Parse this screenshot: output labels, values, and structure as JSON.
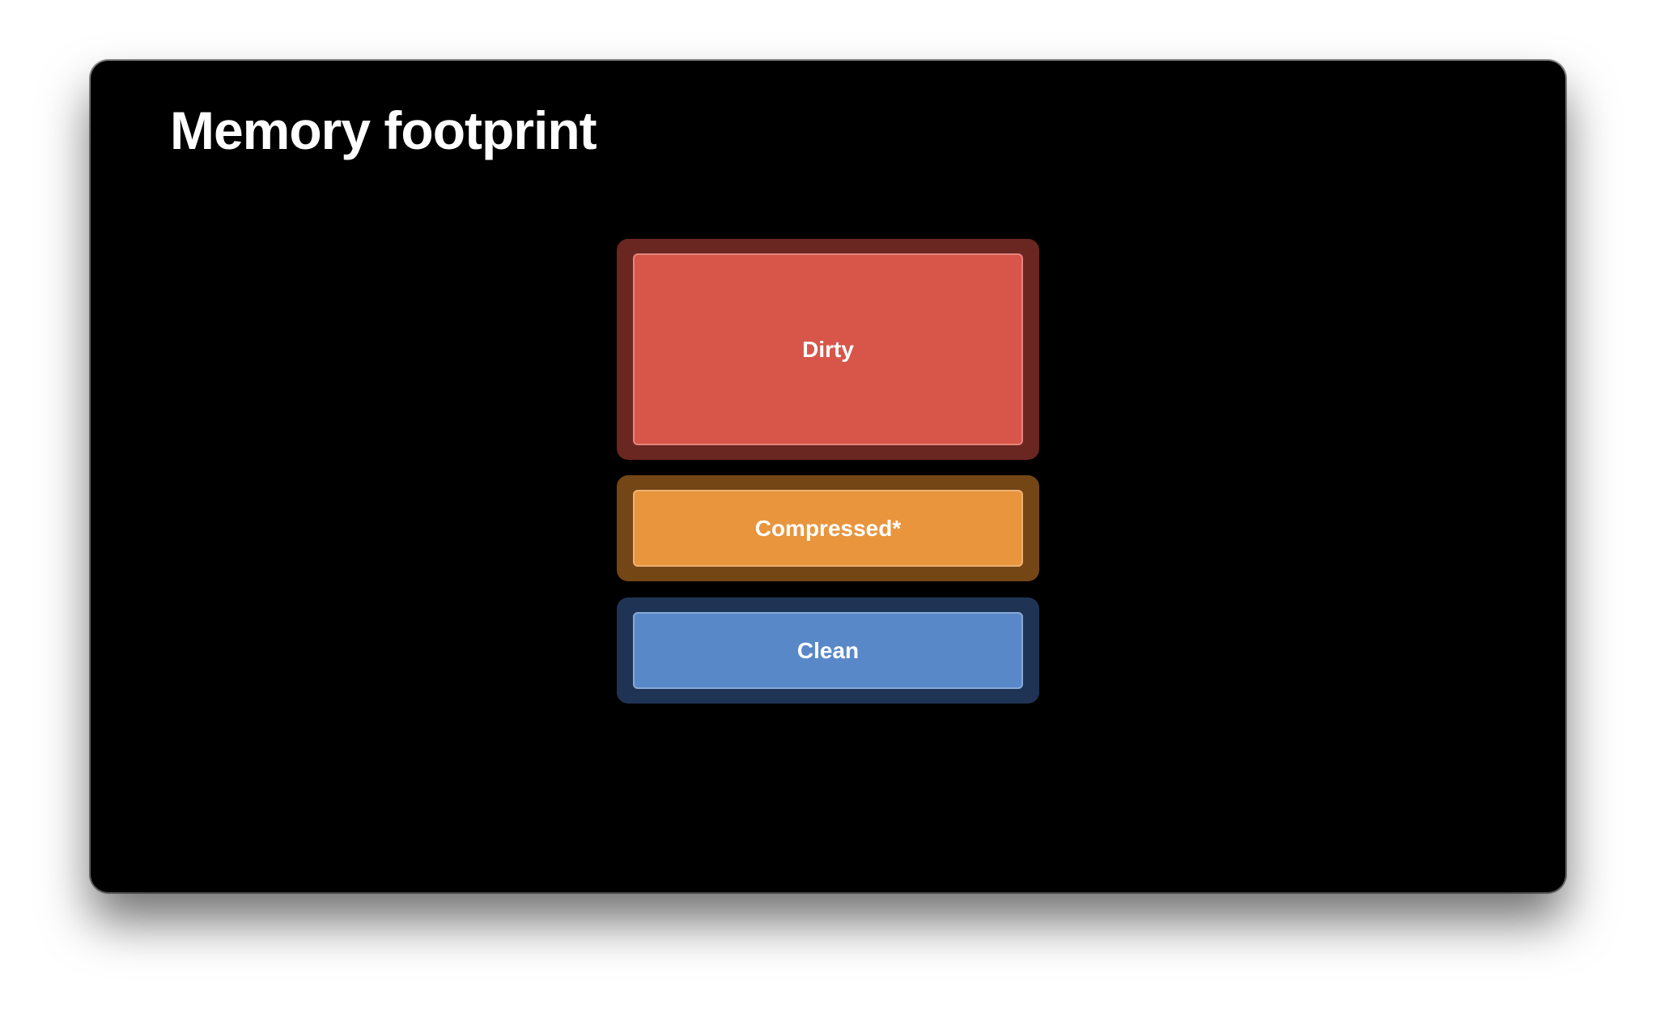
{
  "slide": {
    "title": "Memory footprint"
  },
  "blocks": [
    {
      "id": "dirty",
      "label": "Dirty",
      "fill": "#d75649",
      "frame": "#6a2621"
    },
    {
      "id": "compressed",
      "label": "Compressed*",
      "fill": "#e8953d",
      "frame": "#744616"
    },
    {
      "id": "clean",
      "label": "Clean",
      "fill": "#5988c8",
      "frame": "#1f3455"
    }
  ]
}
